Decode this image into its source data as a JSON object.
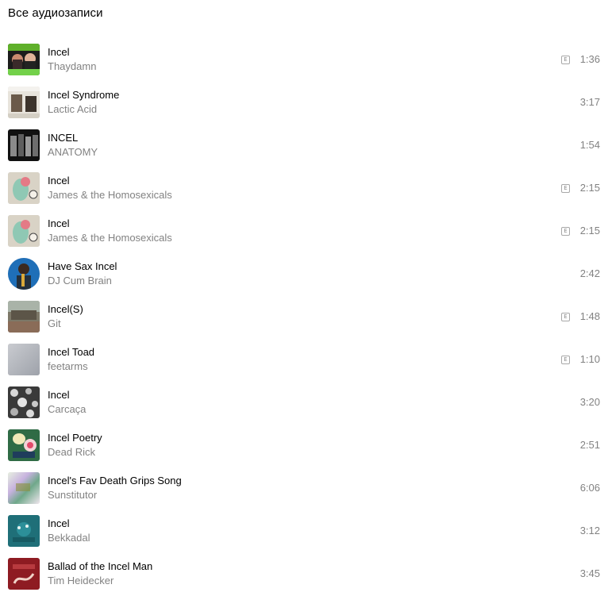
{
  "header": {
    "title": "Все аудиозаписи"
  },
  "tracks": [
    {
      "title": "Incel",
      "artist": "Thaydamn",
      "explicit": true,
      "explicit_mark": "E",
      "duration": "1:36",
      "cover_icon": "album-cover-thaydamn"
    },
    {
      "title": "Incel Syndrome",
      "artist": "Lactic Acid",
      "explicit": false,
      "duration": "3:17",
      "cover_icon": "album-cover-lactic-acid"
    },
    {
      "title": "INCEL",
      "artist": "ANATOMY",
      "explicit": false,
      "duration": "1:54",
      "cover_icon": "album-cover-anatomy"
    },
    {
      "title": "Incel",
      "artist": "James & the Homosexicals",
      "explicit": true,
      "explicit_mark": "E",
      "duration": "2:15",
      "cover_icon": "album-cover-james"
    },
    {
      "title": "Incel",
      "artist": "James & the Homosexicals",
      "explicit": true,
      "explicit_mark": "E",
      "duration": "2:15",
      "cover_icon": "album-cover-james"
    },
    {
      "title": "Have Sax Incel",
      "artist": "DJ Cum Brain",
      "explicit": false,
      "duration": "2:42",
      "cover_icon": "album-cover-dj-cum-brain"
    },
    {
      "title": "Incel(S)",
      "artist": "Git",
      "explicit": true,
      "explicit_mark": "E",
      "duration": "1:48",
      "cover_icon": "album-cover-git"
    },
    {
      "title": "Incel Toad",
      "artist": "feetarms",
      "explicit": true,
      "explicit_mark": "E",
      "duration": "1:10",
      "cover_icon": "album-cover-feetarms"
    },
    {
      "title": "Incel",
      "artist": "Carcaça",
      "explicit": false,
      "duration": "3:20",
      "cover_icon": "album-cover-carcaca"
    },
    {
      "title": "Incel Poetry",
      "artist": "Dead Rick",
      "explicit": false,
      "duration": "2:51",
      "cover_icon": "album-cover-dead-rick"
    },
    {
      "title": "Incel's Fav Death Grips Song",
      "artist": "Sunstitutor",
      "explicit": false,
      "duration": "6:06",
      "cover_icon": "album-cover-sunstitutor"
    },
    {
      "title": "Incel",
      "artist": "Bekkadal",
      "explicit": false,
      "duration": "3:12",
      "cover_icon": "album-cover-bekkadal"
    },
    {
      "title": "Ballad of the Incel Man",
      "artist": "Tim Heidecker",
      "explicit": false,
      "duration": "3:45",
      "cover_icon": "album-cover-tim-heidecker"
    }
  ]
}
